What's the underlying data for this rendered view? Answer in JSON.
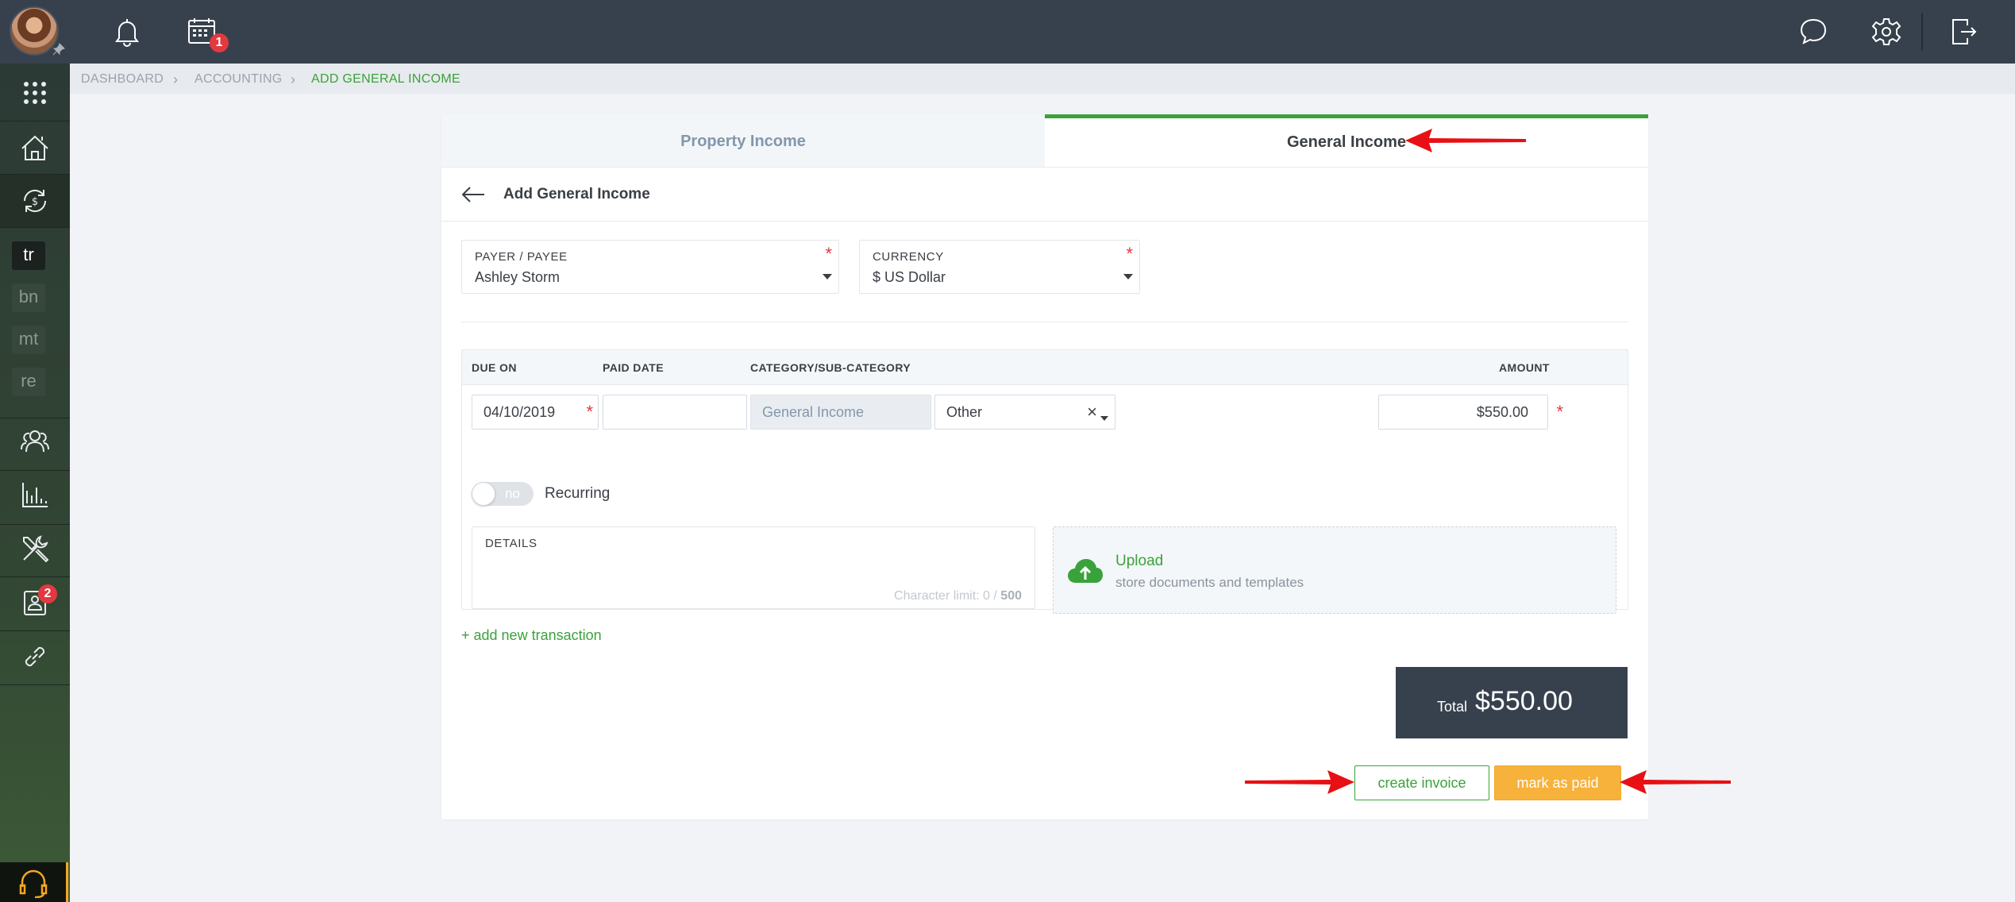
{
  "topbar": {
    "calendar_badge": "1"
  },
  "sidebar": {
    "abbreviations": [
      "tr",
      "bn",
      "mt",
      "re"
    ],
    "contacts_badge": "2"
  },
  "breadcrumb": {
    "items": [
      "DASHBOARD",
      "ACCOUNTING",
      "ADD GENERAL INCOME"
    ]
  },
  "tabs": {
    "property_income": "Property Income",
    "general_income": "General Income"
  },
  "form": {
    "title": "Add General Income",
    "payer_label": "PAYER / PAYEE",
    "payer_value": "Ashley Storm",
    "currency_label": "CURRENCY",
    "currency_value": "$ US Dollar",
    "required_mark": "*"
  },
  "transactions": {
    "columns": {
      "due_on": "DUE ON",
      "paid_date": "PAID DATE",
      "category": "CATEGORY/SUB-CATEGORY",
      "amount": "AMOUNT"
    },
    "row": {
      "due_on": "04/10/2019",
      "paid_date": "",
      "category": "General Income",
      "subcategory": "Other",
      "amount": "$550.00"
    },
    "recurring_toggle": "no",
    "recurring_label": "Recurring",
    "details_label": "DETAILS",
    "char_limit_prefix": "Character limit: 0 /",
    "char_limit_max": "500",
    "upload_title": "Upload",
    "upload_subtitle": "store documents and templates"
  },
  "add_transaction": "+ add new transaction",
  "total": {
    "label": "Total",
    "value": "$550.00"
  },
  "buttons": {
    "create_invoice": "create invoice",
    "mark_as_paid": "mark as paid"
  },
  "colors": {
    "accent_green": "#3aa23a",
    "primary_orange": "#f7b23b",
    "topbar": "#37414d",
    "annotation_red": "#e81014"
  }
}
